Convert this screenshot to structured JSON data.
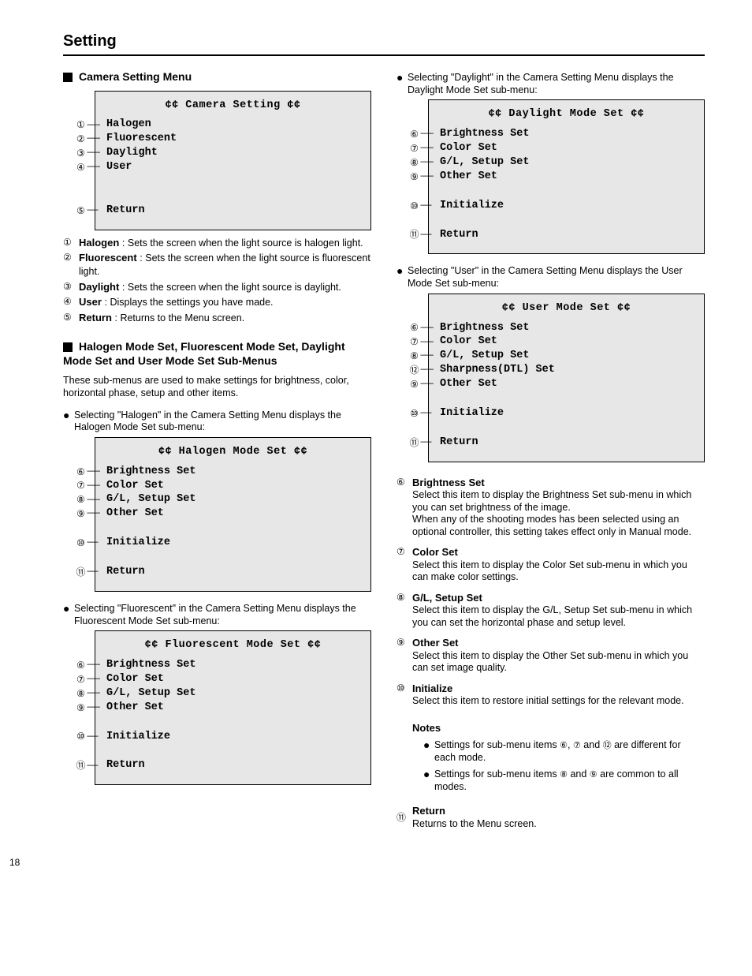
{
  "pageNumber": "18",
  "sectionTitle": "Setting",
  "left": {
    "heading1": "Camera  Setting Menu",
    "menu1": {
      "title": "¢¢ Camera Setting ¢¢",
      "items": [
        {
          "num": "1",
          "label": "Halogen"
        },
        {
          "num": "2",
          "label": "Fluorescent"
        },
        {
          "num": "3",
          "label": "Daylight"
        },
        {
          "num": "4",
          "label": "User"
        }
      ],
      "ret": {
        "num": "5",
        "label": "Return"
      }
    },
    "list1": [
      {
        "num": "1",
        "head": "Halogen       ",
        "desc": ": Sets the screen when the light source is halogen light."
      },
      {
        "num": "2",
        "head": "Fluorescent ",
        "desc": ": Sets the screen when the light source is fluorescent\n  light."
      },
      {
        "num": "3",
        "head": "Daylight      ",
        "desc": ": Sets the screen when the light source is daylight."
      },
      {
        "num": "4",
        "head": "User            ",
        "desc": ": Displays the settings you have made."
      },
      {
        "num": "5",
        "head": "Return         ",
        "desc": ": Returns to the Menu screen."
      }
    ],
    "heading2": "Halogen Mode Set, Fluorescent Mode Set, Daylight Mode Set and User Mode Set Sub-Menus",
    "para2": "These sub-menus are used to make settings for brightness, color, horizontal phase, setup and other items.",
    "bullets": [
      {
        "intro": "Selecting \"Halogen\" in the Camera Setting Menu displays the Halogen Mode Set sub-menu:",
        "menu": {
          "title": "¢¢ Halogen Mode Set ¢¢",
          "items": [
            {
              "num": "6",
              "label": "Brightness Set"
            },
            {
              "num": "7",
              "label": "Color Set"
            },
            {
              "num": "8",
              "label": "G/L, Setup Set"
            },
            {
              "num": "9",
              "label": "Other Set"
            }
          ],
          "init": {
            "num": "0",
            "label": "Initialize"
          },
          "ret": {
            "num": "-",
            "label": "Return"
          }
        }
      },
      {
        "intro": "Selecting \"Fluorescent\" in the Camera Setting Menu displays the Fluorescent Mode Set sub-menu:",
        "menu": {
          "title": "¢¢ Fluorescent Mode Set ¢¢",
          "items": [
            {
              "num": "6",
              "label": "Brightness Set"
            },
            {
              "num": "7",
              "label": "Color Set"
            },
            {
              "num": "8",
              "label": "G/L, Setup Set"
            },
            {
              "num": "9",
              "label": "Other Set"
            }
          ],
          "init": {
            "num": "0",
            "label": "Initialize"
          },
          "ret": {
            "num": "-",
            "label": "Return"
          }
        }
      }
    ]
  },
  "right": {
    "bullets": [
      {
        "intro": "Selecting \"Daylight\" in the Camera Setting Menu displays the Daylight Mode Set sub-menu:",
        "menu": {
          "title": "¢¢ Daylight Mode Set ¢¢",
          "items": [
            {
              "num": "6",
              "label": "Brightness Set"
            },
            {
              "num": "7",
              "label": "Color Set"
            },
            {
              "num": "8",
              "label": "G/L, Setup Set"
            },
            {
              "num": "9",
              "label": "Other Set"
            }
          ],
          "init": {
            "num": "0",
            "label": "Initialize"
          },
          "ret": {
            "num": "-",
            "label": "Return"
          }
        }
      },
      {
        "intro": "Selecting \"User\" in the Camera Setting Menu displays the User Mode Set sub-menu:",
        "menu": {
          "title": "¢¢ User Mode Set ¢¢",
          "items": [
            {
              "num": "6",
              "label": "Brightness Set"
            },
            {
              "num": "7",
              "label": "Color Set"
            },
            {
              "num": "8",
              "label": "G/L, Setup Set"
            },
            {
              "num": "=",
              "label": "Sharpness(DTL) Set"
            },
            {
              "num": "9",
              "label": "Other Set"
            }
          ],
          "init": {
            "num": "0",
            "label": "Initialize"
          },
          "ret": {
            "num": "-",
            "label": "Return"
          }
        }
      }
    ],
    "list": [
      {
        "num": "6",
        "head": "Brightness Set",
        "desc": "Select this item to display the Brightness Set sub-menu in which you can set brightness of the image.",
        "extra": "When any of the shooting modes has been selected using an optional controller, this setting takes effect only in Manual mode."
      },
      {
        "num": "7",
        "head": "Color Set",
        "desc": "Select this item to display the Color Set sub-menu in which you can make color settings."
      },
      {
        "num": "8",
        "head": "G/L, Setup Set",
        "desc": "Select this item to display the G/L, Setup Set sub-menu in which you can set the horizontal phase and setup level."
      },
      {
        "num": "9",
        "head": "Other Set",
        "desc": "Select this item to display the Other Set sub-menu in which you can set image quality."
      },
      {
        "num": "0",
        "head": "Initialize",
        "desc": "Select this item to restore initial settings for the relevant mode."
      }
    ],
    "subBullets": [
      "Settings for sub-menu items 6, 7 and = are different for each mode.",
      "Settings for sub-menu items 8 and 9 are common to all modes."
    ],
    "ret": {
      "num": "-",
      "head": "Return",
      "desc": "Returns to the Menu screen."
    },
    "notes": "Notes"
  }
}
